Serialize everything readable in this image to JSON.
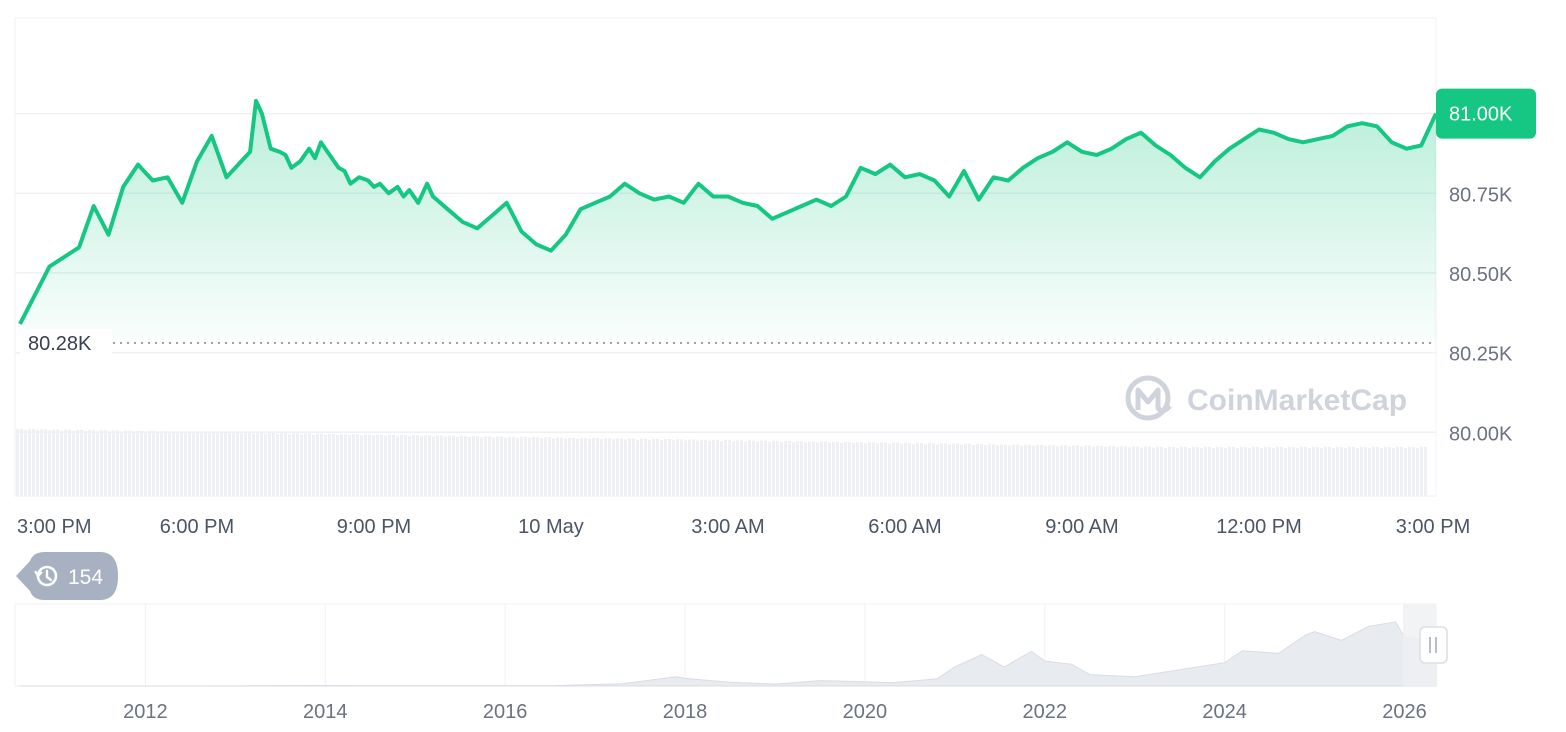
{
  "watermark": {
    "text": "CoinMarketCap",
    "icon": "coinmarketcap-logo-icon"
  },
  "history_badge": {
    "icon": "history-icon",
    "count": "154"
  },
  "colors": {
    "line": "#16c784",
    "badge": "#16c784",
    "history_badge": "#a7b1c2",
    "grid": "#eef0f3",
    "volume": "#eef0f3"
  },
  "chart_data": [
    {
      "type": "area",
      "y_unit": "USD",
      "ylim": [
        79.8,
        81.3
      ],
      "y_scale_note": "thousands",
      "y_ticks": [
        "80.00K",
        "80.25K",
        "80.50K",
        "80.75K",
        "81.00K"
      ],
      "y_tick_values": [
        80.0,
        80.25,
        80.5,
        80.75,
        81.0
      ],
      "x_ticks": [
        "3:00 PM",
        "6:00 PM",
        "9:00 PM",
        "10 May",
        "3:00 AM",
        "6:00 AM",
        "9:00 AM",
        "12:00 PM",
        "3:00 PM"
      ],
      "x_tick_hours": [
        0,
        3,
        6,
        9,
        12,
        15,
        18,
        21,
        24
      ],
      "x_range_hours": [
        -0.05,
        24.0
      ],
      "open_label": "80.28K",
      "open_value": 80.28,
      "current_label": "81.00K",
      "current_value": 81.0,
      "grid": true,
      "x_hours": [
        0.0,
        0.5,
        1.0,
        1.25,
        1.5,
        1.75,
        2.0,
        2.25,
        2.5,
        2.75,
        3.0,
        3.25,
        3.5,
        3.75,
        3.9,
        4.0,
        4.1,
        4.25,
        4.4,
        4.5,
        4.6,
        4.75,
        4.9,
        5.0,
        5.1,
        5.25,
        5.4,
        5.5,
        5.6,
        5.75,
        5.9,
        6.0,
        6.1,
        6.25,
        6.4,
        6.5,
        6.6,
        6.75,
        6.9,
        7.0,
        7.25,
        7.5,
        7.75,
        8.0,
        8.25,
        8.5,
        8.75,
        9.0,
        9.25,
        9.5,
        9.75,
        10.0,
        10.25,
        10.5,
        10.75,
        11.0,
        11.25,
        11.5,
        11.75,
        12.0,
        12.25,
        12.5,
        12.75,
        13.0,
        13.25,
        13.5,
        13.75,
        14.0,
        14.25,
        14.5,
        14.75,
        15.0,
        15.25,
        15.5,
        15.75,
        16.0,
        16.25,
        16.5,
        16.75,
        17.0,
        17.25,
        17.5,
        17.75,
        18.0,
        18.25,
        18.5,
        18.75,
        19.0,
        19.25,
        19.5,
        19.75,
        20.0,
        20.25,
        20.5,
        20.75,
        21.0,
        21.25,
        21.5,
        21.75,
        22.0,
        22.25,
        22.5,
        22.75,
        23.0,
        23.25,
        23.5,
        23.75,
        24.0
      ],
      "values": [
        80.34,
        80.52,
        80.58,
        80.71,
        80.62,
        80.77,
        80.84,
        80.79,
        80.8,
        80.72,
        80.85,
        80.93,
        80.8,
        80.85,
        80.88,
        81.04,
        81.0,
        80.89,
        80.88,
        80.87,
        80.83,
        80.85,
        80.89,
        80.86,
        80.91,
        80.87,
        80.83,
        80.82,
        80.78,
        80.8,
        80.79,
        80.77,
        80.78,
        80.75,
        80.77,
        80.74,
        80.76,
        80.72,
        80.78,
        80.74,
        80.7,
        80.66,
        80.64,
        80.68,
        80.72,
        80.63,
        80.59,
        80.57,
        80.62,
        80.7,
        80.72,
        80.74,
        80.78,
        80.75,
        80.73,
        80.74,
        80.72,
        80.78,
        80.74,
        80.74,
        80.72,
        80.71,
        80.67,
        80.69,
        80.71,
        80.73,
        80.71,
        80.74,
        80.83,
        80.81,
        80.84,
        80.8,
        80.81,
        80.79,
        80.74,
        80.82,
        80.73,
        80.8,
        80.79,
        80.83,
        80.86,
        80.88,
        80.91,
        80.88,
        80.87,
        80.89,
        80.92,
        80.94,
        80.9,
        80.87,
        80.83,
        80.8,
        80.85,
        80.89,
        80.92,
        80.95,
        80.94,
        80.92,
        80.91,
        80.92,
        80.93,
        80.96,
        80.97,
        80.96,
        80.91,
        80.89,
        80.9,
        81.0
      ]
    },
    {
      "type": "area",
      "role": "navigator",
      "x_ticks": [
        "2012",
        "2014",
        "2016",
        "2018",
        "2020",
        "2022",
        "2024",
        "2026"
      ],
      "x_tick_years": [
        2012,
        2014,
        2016,
        2018,
        2020,
        2022,
        2024,
        2026
      ],
      "x_range_years": [
        2010.55,
        2026.35
      ],
      "y_unit": "USD",
      "ylim": [
        0,
        140000
      ],
      "x_years": [
        2010.6,
        2012.0,
        2013.0,
        2013.9,
        2014.5,
        2015.5,
        2016.5,
        2017.3,
        2017.9,
        2018.0,
        2018.5,
        2019.0,
        2019.5,
        2020.0,
        2020.3,
        2020.8,
        2021.0,
        2021.3,
        2021.55,
        2021.85,
        2022.0,
        2022.3,
        2022.5,
        2023.0,
        2023.5,
        2024.0,
        2024.2,
        2024.6,
        2024.9,
        2025.0,
        2025.3,
        2025.6,
        2025.9,
        2026.0,
        2026.35
      ],
      "values": [
        0,
        5,
        100,
        1000,
        600,
        300,
        600,
        4000,
        17000,
        14000,
        7000,
        3500,
        10000,
        8000,
        6000,
        13000,
        35000,
        58000,
        35000,
        64000,
        46000,
        40000,
        21000,
        17000,
        30000,
        43000,
        65000,
        60000,
        94000,
        100000,
        84000,
        110000,
        118000,
        90000,
        80000
      ]
    }
  ]
}
